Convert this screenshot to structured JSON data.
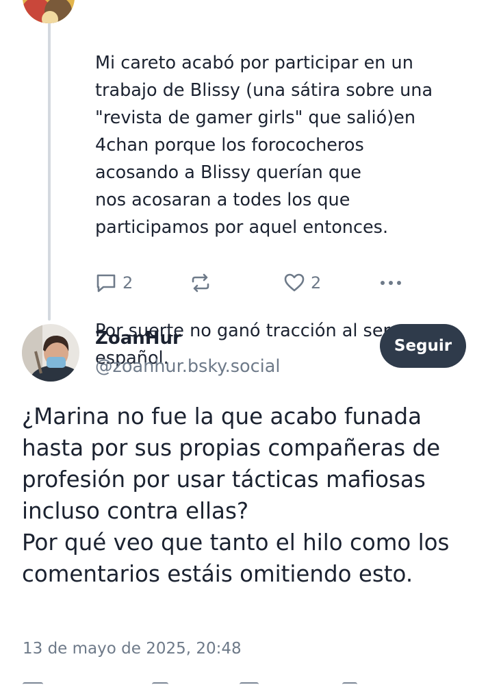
{
  "reply_post": {
    "paragraphs": [
      "Mi careto acabó por participar en un\ntrabajo de Blissy (una sátira sobre una\n\"revista de gamer girls\" que salió)en\n4chan porque los forococheros\nacosando a Blissy querían que\nnos acosaran a todes los que\nparticipamos por aquel entonces.",
      "Por suerte no ganó tracción al ser en\nespañol."
    ],
    "reply_count": "2",
    "like_count": "2"
  },
  "main_post": {
    "author_name": "ZoanHur",
    "author_handle": "@zoanhur.bsky.social",
    "follow_label": "Seguir",
    "paragraphs": [
      "¿Marina no fue la que acabo funada hasta por sus propias compañeras de profesión por usar tácticas mafiosas incluso contra ellas?",
      "Por qué veo que tanto el hilo como los comentarios estáis omitiendo esto."
    ],
    "timestamp": "13 de mayo de 2025, 20:48"
  },
  "icons": {
    "reply": "speech-bubble-icon",
    "repost": "repost-arrows-icon",
    "like": "heart-icon",
    "more": "more-dots-icon"
  },
  "colors": {
    "text": "#1b2230",
    "muted": "#6e7a89",
    "follow_button": "#2f3b4b",
    "thread_line": "#d4d9df"
  }
}
